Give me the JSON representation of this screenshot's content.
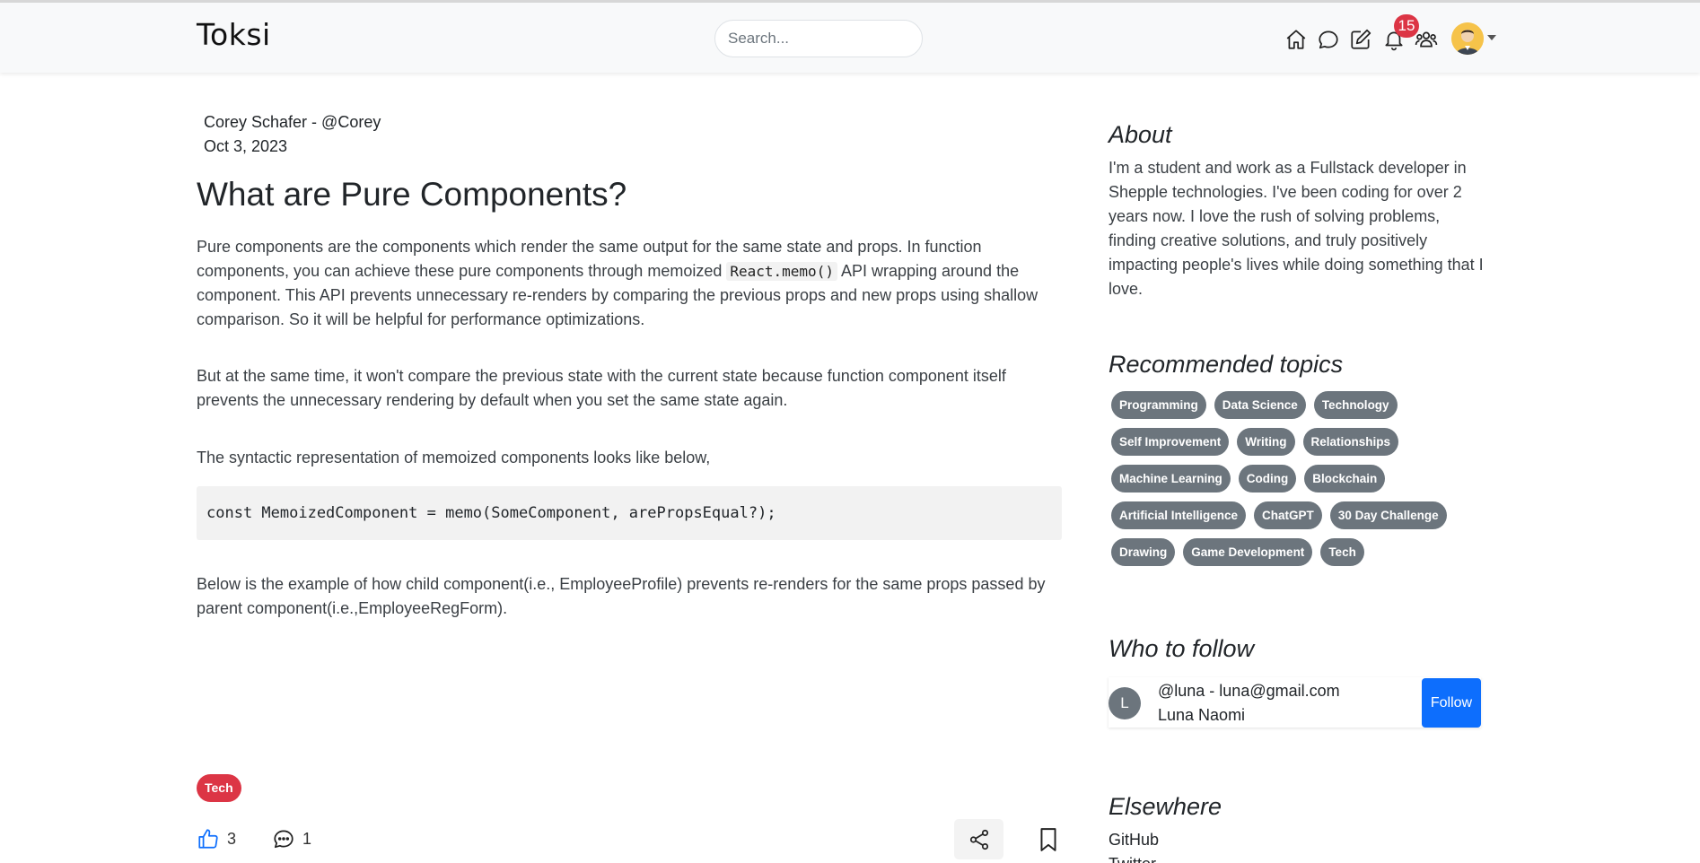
{
  "navbar": {
    "brand": "Toksi",
    "search_placeholder": "Search...",
    "notification_count": "15"
  },
  "article": {
    "author": "Corey Schafer - @Corey",
    "date": "Oct 3, 2023",
    "title": "What are Pure Components?",
    "p1_part1": "Pure components are the components which render the same output for the same state and props. In function components, you can achieve these pure components through memoized ",
    "p1_code": "React.memo()",
    "p1_part2": " API wrapping around the component. This API prevents unnecessary re-renders by comparing the previous props and new props using shallow comparison. So it will be helpful for performance optimizations.",
    "p2": "But at the same time, it won't compare the previous state with the current state because function component itself prevents the unnecessary rendering by default when you set the same state again.",
    "p3": "The syntactic representation of memoized components looks like below,",
    "code": "const MemoizedComponent = memo(SomeComponent, arePropsEqual?);",
    "p4": "Below is the example of how child component(i.e., EmployeeProfile) prevents re-renders for the same props passed by parent component(i.e.,EmployeeRegForm).",
    "tag": "Tech",
    "likes": "3",
    "comments": "1"
  },
  "sidebar": {
    "about_heading": "About",
    "about_text": "I'm a student and work as a Fullstack developer in Shepple technologies. I've been coding for over 2 years now. I love the rush of solving problems, finding creative solutions, and truly positively impacting people's lives while doing something that I love.",
    "topics_heading": "Recommended topics",
    "topic_rows": [
      [
        "Programming",
        "Data Science",
        "Technology"
      ],
      [
        "Self Improvement",
        "Writing",
        "Relationships"
      ],
      [
        "Machine Learning",
        "Coding",
        "Blockchain"
      ],
      [
        "Artificial Intelligence",
        "ChatGPT",
        "30 Day Challenge"
      ],
      [
        "Drawing",
        "Game Development",
        "Tech"
      ]
    ],
    "follow_heading": "Who to follow",
    "follow": {
      "initial": "L",
      "handle": "@luna - luna@gmail.com",
      "name": "Luna Naomi",
      "button": "Follow"
    },
    "elsewhere_heading": "Elsewhere",
    "elsewhere_links": [
      "GitHub",
      "Twitter"
    ]
  }
}
